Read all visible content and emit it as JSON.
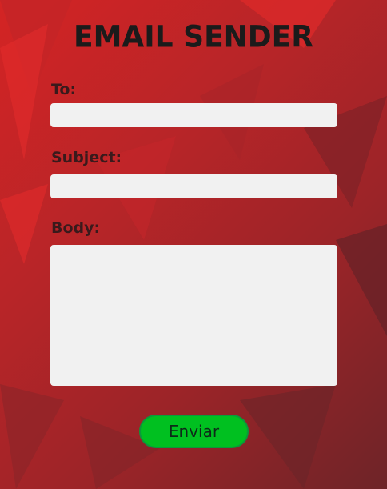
{
  "title": "EMAIL SENDER",
  "form": {
    "to_label": "To:",
    "to_value": "",
    "subject_label": "Subject:",
    "subject_value": "",
    "body_label": "Body:",
    "body_value": "",
    "submit_label": "Enviar"
  },
  "colors": {
    "button": "#00c020",
    "field": "#f1f1f1",
    "background": "#b82528"
  }
}
